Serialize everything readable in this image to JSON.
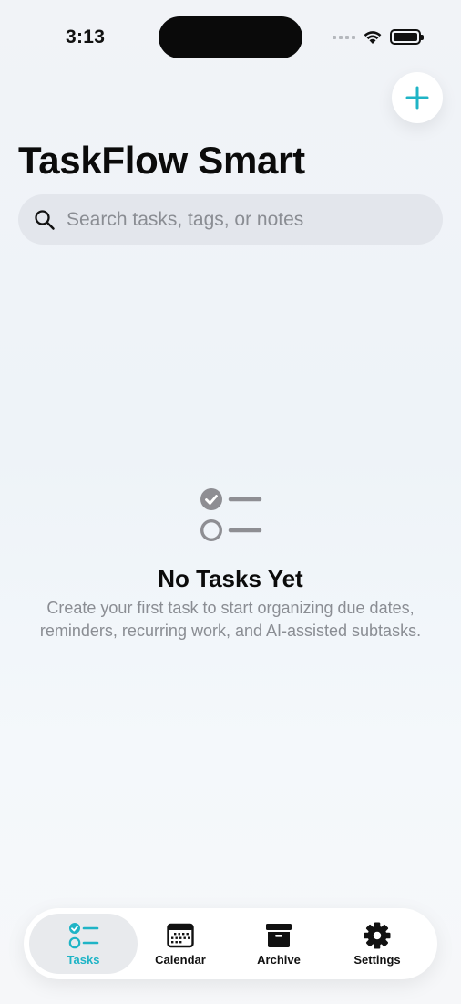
{
  "status_bar": {
    "time": "3:13"
  },
  "header": {
    "title": "TaskFlow Smart"
  },
  "search": {
    "placeholder": "Search tasks, tags, or notes",
    "value": ""
  },
  "empty_state": {
    "title": "No Tasks Yet",
    "description": "Create your first task to start organizing due dates, reminders, recurring work, and AI-assisted subtasks.",
    "icon": "checklist-icon"
  },
  "tabs": [
    {
      "label": "Tasks",
      "icon": "checklist-icon",
      "active": true
    },
    {
      "label": "Calendar",
      "icon": "calendar-icon",
      "active": false
    },
    {
      "label": "Archive",
      "icon": "archive-box-icon",
      "active": false
    },
    {
      "label": "Settings",
      "icon": "gear-icon",
      "active": false
    }
  ],
  "colors": {
    "accent": "#1fb4c6",
    "text": "#0b0b0b",
    "secondary_text": "#8a8d93",
    "search_bg": "#e3e6ec"
  }
}
